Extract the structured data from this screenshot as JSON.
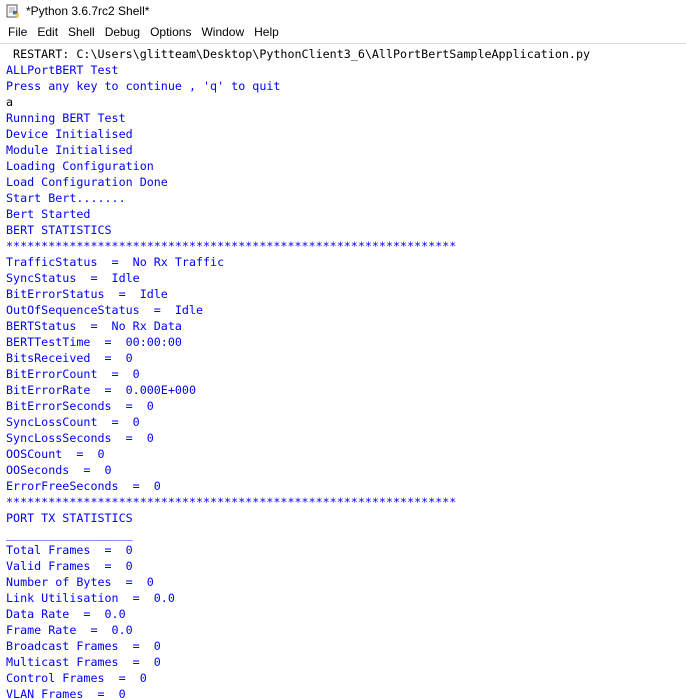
{
  "window": {
    "title": "*Python 3.6.7rc2 Shell*",
    "icon": "python-idle-icon"
  },
  "menu": [
    {
      "key": "file",
      "label": "File"
    },
    {
      "key": "edit",
      "label": "Edit"
    },
    {
      "key": "shell",
      "label": "Shell"
    },
    {
      "key": "debug",
      "label": "Debug"
    },
    {
      "key": "options",
      "label": "Options"
    },
    {
      "key": "window",
      "label": "Window"
    },
    {
      "key": "help",
      "label": "Help"
    }
  ],
  "colors": {
    "output": "#0000ff",
    "input": "#000000"
  },
  "shell": {
    "lines": [
      {
        "kind": "restart",
        "text": " RESTART: C:\\Users\\glitteam\\Desktop\\PythonClient3_6\\AllPortBertSampleApplication.py"
      },
      {
        "kind": "output",
        "text": "ALLPortBERT Test"
      },
      {
        "kind": "output",
        "text": "Press any key to continue , 'q' to quit"
      },
      {
        "kind": "stdin",
        "text": "a"
      },
      {
        "kind": "output",
        "text": "Running BERT Test"
      },
      {
        "kind": "output",
        "text": "Device Initialised"
      },
      {
        "kind": "output",
        "text": "Module Initialised"
      },
      {
        "kind": "output",
        "text": "Loading Configuration"
      },
      {
        "kind": "output",
        "text": "Load Configuration Done"
      },
      {
        "kind": "output",
        "text": "Start Bert......."
      },
      {
        "kind": "output",
        "text": "Bert Started"
      },
      {
        "kind": "output",
        "text": "BERT STATISTICS"
      },
      {
        "kind": "separator",
        "text": "****************************************************************"
      },
      {
        "kind": "output",
        "text": "TrafficStatus  =  No Rx Traffic"
      },
      {
        "kind": "output",
        "text": "SyncStatus  =  Idle"
      },
      {
        "kind": "output",
        "text": "BitErrorStatus  =  Idle"
      },
      {
        "kind": "output",
        "text": "OutOfSequenceStatus  =  Idle"
      },
      {
        "kind": "output",
        "text": "BERTStatus  =  No Rx Data"
      },
      {
        "kind": "output",
        "text": "BERTTestTime  =  00:00:00"
      },
      {
        "kind": "output",
        "text": "BitsReceived  =  0"
      },
      {
        "kind": "output",
        "text": "BitErrorCount  =  0"
      },
      {
        "kind": "output",
        "text": "BitErrorRate  =  0.000E+000"
      },
      {
        "kind": "output",
        "text": "BitErrorSeconds  =  0"
      },
      {
        "kind": "output",
        "text": "SyncLossCount  =  0"
      },
      {
        "kind": "output",
        "text": "SyncLossSeconds  =  0"
      },
      {
        "kind": "output",
        "text": "OOSCount  =  0"
      },
      {
        "kind": "output",
        "text": "OOSeconds  =  0"
      },
      {
        "kind": "output",
        "text": "ErrorFreeSeconds  =  0"
      },
      {
        "kind": "separator",
        "text": "****************************************************************"
      },
      {
        "kind": "output",
        "text": "PORT TX STATISTICS"
      },
      {
        "kind": "output",
        "text": "__________________"
      },
      {
        "kind": "output",
        "text": "Total Frames  =  0"
      },
      {
        "kind": "output",
        "text": "Valid Frames  =  0"
      },
      {
        "kind": "output",
        "text": "Number of Bytes  =  0"
      },
      {
        "kind": "output",
        "text": "Link Utilisation  =  0.0"
      },
      {
        "kind": "output",
        "text": "Data Rate  =  0.0"
      },
      {
        "kind": "output",
        "text": "Frame Rate  =  0.0"
      },
      {
        "kind": "output",
        "text": "Broadcast Frames  =  0"
      },
      {
        "kind": "output",
        "text": "Multicast Frames  =  0"
      },
      {
        "kind": "output",
        "text": "Control Frames  =  0"
      },
      {
        "kind": "output",
        "text": "VLAN Frames  =  0"
      }
    ]
  }
}
